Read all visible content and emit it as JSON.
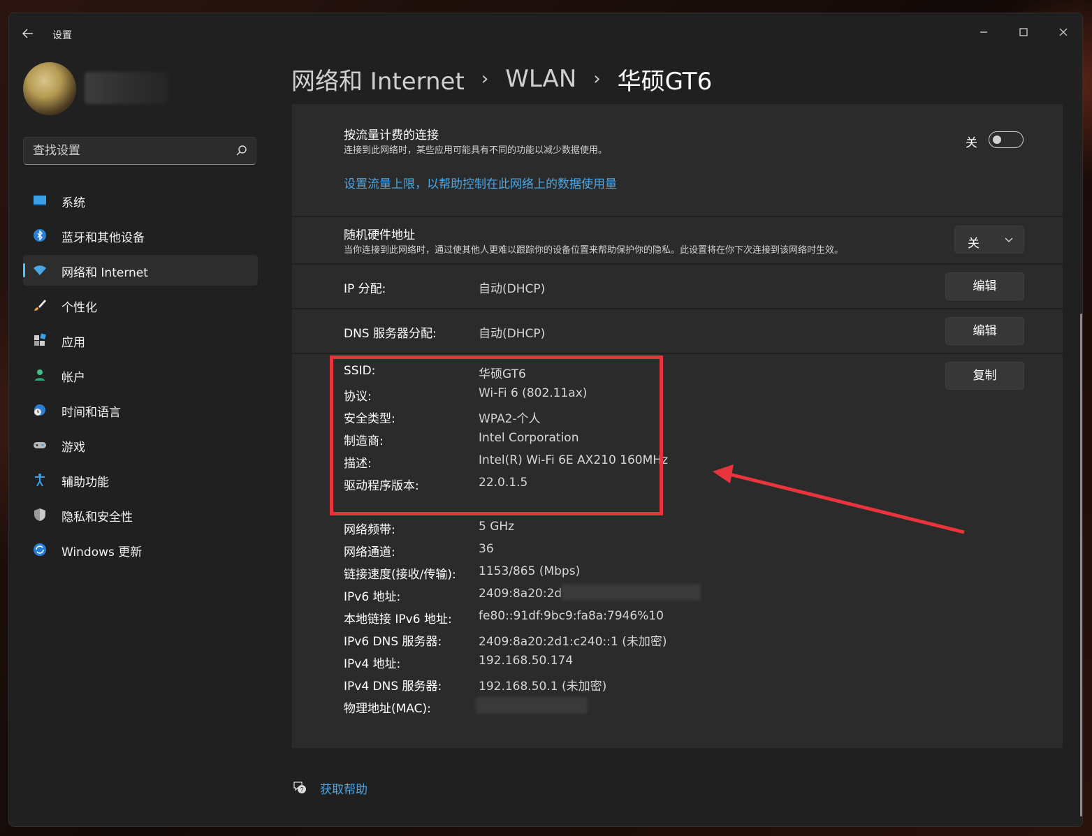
{
  "window": {
    "app_title": "设置",
    "controls": {
      "minimize": "—",
      "maximize": "☐",
      "close": "✕"
    }
  },
  "sidebar": {
    "search_placeholder": "查找设置",
    "items": [
      {
        "label": "系统",
        "icon": "system-icon"
      },
      {
        "label": "蓝牙和其他设备",
        "icon": "bluetooth-icon"
      },
      {
        "label": "网络和 Internet",
        "icon": "wifi-icon",
        "active": true
      },
      {
        "label": "个性化",
        "icon": "brush-icon"
      },
      {
        "label": "应用",
        "icon": "apps-icon"
      },
      {
        "label": "帐户",
        "icon": "account-icon"
      },
      {
        "label": "时间和语言",
        "icon": "globe-clock-icon"
      },
      {
        "label": "游戏",
        "icon": "gamepad-icon"
      },
      {
        "label": "辅助功能",
        "icon": "accessibility-icon"
      },
      {
        "label": "隐私和安全性",
        "icon": "shield-icon"
      },
      {
        "label": "Windows 更新",
        "icon": "update-icon"
      }
    ]
  },
  "breadcrumb": {
    "items": [
      "网络和 Internet",
      "WLAN",
      "华硕GT6"
    ],
    "separator": "›"
  },
  "metered": {
    "title": "按流量计费的连接",
    "description": "连接到此网络时，某些应用可能具有不同的功能以减少数据使用。",
    "toggle_label": "关",
    "toggle_on": false,
    "link": "设置流量上限，以帮助控制在此网络上的数据使用量"
  },
  "random_hw": {
    "title": "随机硬件地址",
    "description": "当你连接到此网络时，通过使其他人更难以跟踪你的设备位置来帮助保护你的隐私。此设置将在你下次连接到该网络时生效。",
    "value": "关"
  },
  "ip_assign": {
    "label": "IP 分配:",
    "value": "自动(DHCP)",
    "button": "编辑"
  },
  "dns_assign": {
    "label": "DNS 服务器分配:",
    "value": "自动(DHCP)",
    "button": "编辑"
  },
  "properties": {
    "copy_button": "复制",
    "rows": [
      {
        "label": "SSID:",
        "value": "华硕GT6"
      },
      {
        "label": "协议:",
        "value": "Wi-Fi 6 (802.11ax)"
      },
      {
        "label": "安全类型:",
        "value": "WPA2-个人"
      },
      {
        "label": "制造商:",
        "value": "Intel Corporation"
      },
      {
        "label": "描述:",
        "value": "Intel(R) Wi-Fi 6E AX210 160MHz"
      },
      {
        "label": "驱动程序版本:",
        "value": "22.0.1.5"
      },
      {
        "label": "网络频带:",
        "value": "5 GHz"
      },
      {
        "label": "网络通道:",
        "value": "36"
      },
      {
        "label": "链接速度(接收/传输):",
        "value": "1153/865 (Mbps)"
      },
      {
        "label": "IPv6 地址:",
        "value": "2409:8a20:2d1:"
      },
      {
        "label": "本地链接 IPv6 地址:",
        "value": "fe80::91df:9bc9:fa8a:7946%10"
      },
      {
        "label": "IPv6 DNS 服务器:",
        "value": "2409:8a20:2d1:c240::1 (未加密)"
      },
      {
        "label": "IPv4 地址:",
        "value": "192.168.50.174"
      },
      {
        "label": "IPv4 DNS 服务器:",
        "value": "192.168.50.1 (未加密)"
      },
      {
        "label": "物理地址(MAC):",
        "value": ""
      }
    ]
  },
  "help": {
    "label": "获取帮助"
  },
  "colors": {
    "accent": "#4cc2ff",
    "link": "#4aa6e4",
    "annotation": "#e8343a"
  }
}
